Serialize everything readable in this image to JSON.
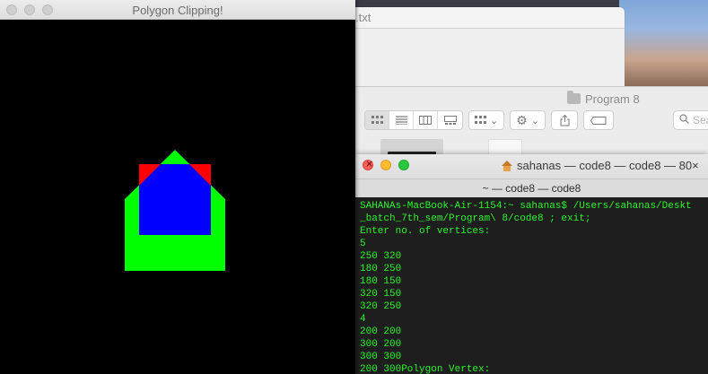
{
  "text_window": {
    "title": ".txt"
  },
  "finder": {
    "title": "Program 8",
    "toolbar": {
      "view_icons": [
        "icon-view",
        "list-view",
        "column-view",
        "gallery-view"
      ],
      "group_label": "",
      "action_label": "",
      "search_placeholder": "Sear"
    }
  },
  "terminal": {
    "title": "sahanas — code8 — code8 — 80×",
    "tab_title": "~ — code8 — code8",
    "lines": [
      "SAHANAs-MacBook-Air-1154:~ sahanas$ /Users/sahanas/Deskt",
      "_batch_7th_sem/Program\\ 8/code8 ; exit;",
      "Enter no. of vertices:",
      "5",
      "250 320",
      "180 250",
      "180 150",
      "320 150",
      "320 250",
      "4",
      "200 200",
      "300 200",
      "300 300",
      "200 300Polygon Vertex:"
    ]
  },
  "polygon_window": {
    "title": "Polygon Clipping!",
    "colors": {
      "background": "#000000",
      "polygon": "#00ff00",
      "clip_window": "#ff0000",
      "clipped": "#0000ff"
    }
  }
}
